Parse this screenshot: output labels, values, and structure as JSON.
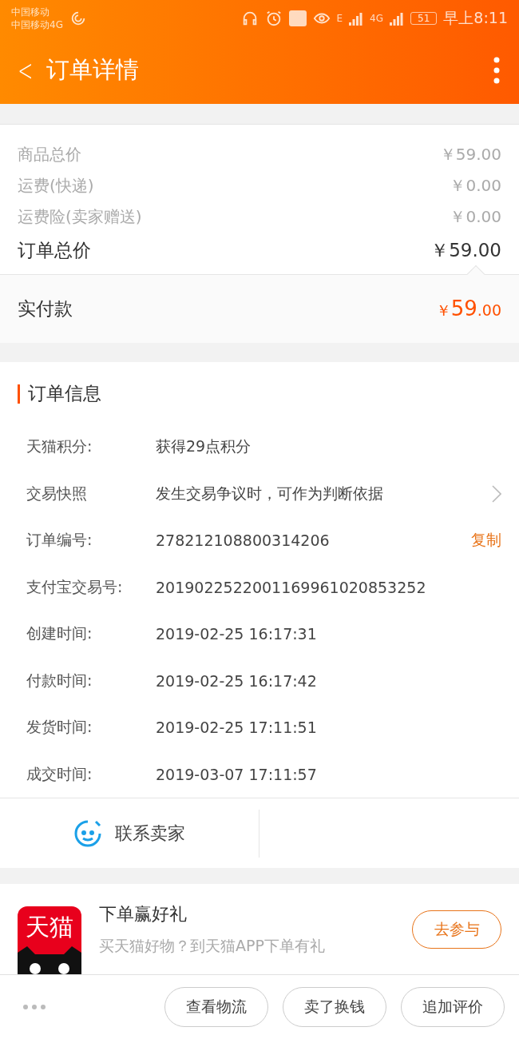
{
  "status_bar": {
    "carriers": [
      "中国移动",
      "中国移动4G"
    ],
    "network_labels": [
      "E",
      "4G"
    ],
    "battery": "51",
    "time": "早上8:11"
  },
  "header": {
    "back": "<",
    "title": "订单详情"
  },
  "summary": {
    "rows": [
      {
        "label": "商品总价",
        "value": "￥59.00",
        "kind": "minor"
      },
      {
        "label": "运费(快递)",
        "value": "￥0.00",
        "kind": "minor"
      },
      {
        "label": "运费险(卖家赠送)",
        "value": "￥0.00",
        "kind": "minor"
      },
      {
        "label": "订单总价",
        "value": "￥59.00",
        "kind": "total"
      }
    ],
    "paid": {
      "label": "实付款",
      "currency": "￥",
      "integer": "59",
      "decimal": ".00"
    }
  },
  "order_info": {
    "title": "订单信息",
    "rows": [
      {
        "label": "天猫积分:",
        "value": "获得29点积分",
        "kind": "plain"
      },
      {
        "label": "交易快照",
        "value": "发生交易争议时，可作为判断依据",
        "kind": "link"
      },
      {
        "label": "订单编号:",
        "value": "278212108800314206",
        "kind": "copy",
        "action": "复制"
      },
      {
        "label": "支付宝交易号:",
        "value": "2019022522001169961020853252",
        "kind": "plain"
      },
      {
        "label": "创建时间:",
        "value": "2019-02-25 16:17:31",
        "kind": "plain"
      },
      {
        "label": "付款时间:",
        "value": "2019-02-25 16:17:42",
        "kind": "plain"
      },
      {
        "label": "发货时间:",
        "value": "2019-02-25 17:11:51",
        "kind": "plain"
      },
      {
        "label": "成交时间:",
        "value": "2019-03-07 17:11:57",
        "kind": "plain"
      }
    ]
  },
  "contact": {
    "label": "联系卖家"
  },
  "promo": {
    "logo_text": "天猫",
    "title": "下单赢好礼",
    "subtitle": "买天猫好物？到天猫APP下单有礼",
    "button": "去参与"
  },
  "bottom_bar": {
    "buttons": [
      "查看物流",
      "卖了换钱",
      "追加评价"
    ]
  }
}
